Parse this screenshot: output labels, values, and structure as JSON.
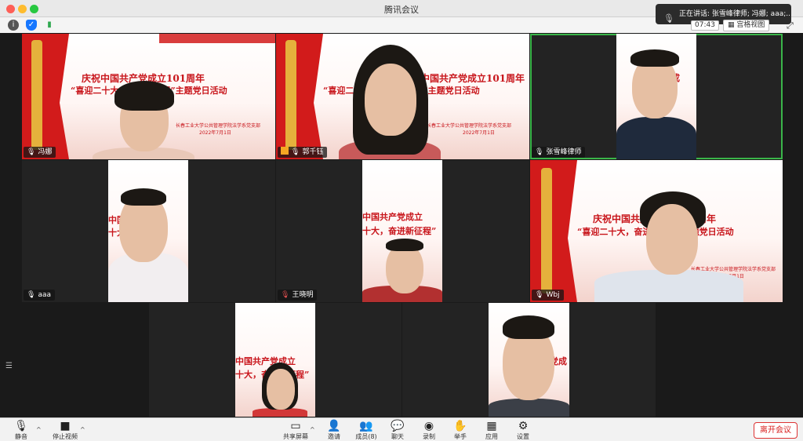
{
  "window": {
    "title": "腾讯会议"
  },
  "speaking_banner": "正在讲话: 张雪峰律师; 冯娜; aaa;...",
  "meeting_timer": "07:43",
  "view_mode": "宫格视图",
  "banner_text": {
    "line1": "庆祝中国共产党成立101周年",
    "line2": "“喜迎二十大，奋进新征程”主题党日活动",
    "org": "长春工业大学公共管理学院法学系党支部",
    "date": "2022年7月1日",
    "line1_cut": "中国共产党成立",
    "line2_cut": "十大，奋进新征程”"
  },
  "participants": [
    {
      "name": "冯娜"
    },
    {
      "name": "郭千钰"
    },
    {
      "name": "张雪峰律师"
    },
    {
      "name": "aaa"
    },
    {
      "name": "王晓明"
    },
    {
      "name": "Wbj"
    },
    {
      "name": ""
    },
    {
      "name": ""
    }
  ],
  "toolbar": {
    "mute": "静音",
    "stop_video": "停止视频",
    "share_screen": "共享屏幕",
    "invite": "邀请",
    "members": "成员(8)",
    "chat": "聊天",
    "record": "录制",
    "raise_hand": "举手",
    "apps": "应用",
    "settings": "设置",
    "leave": "离开会议"
  },
  "colors": {
    "accent_green": "#3ab549",
    "leave_red": "#d8201f",
    "banner_red": "#c8151b"
  }
}
